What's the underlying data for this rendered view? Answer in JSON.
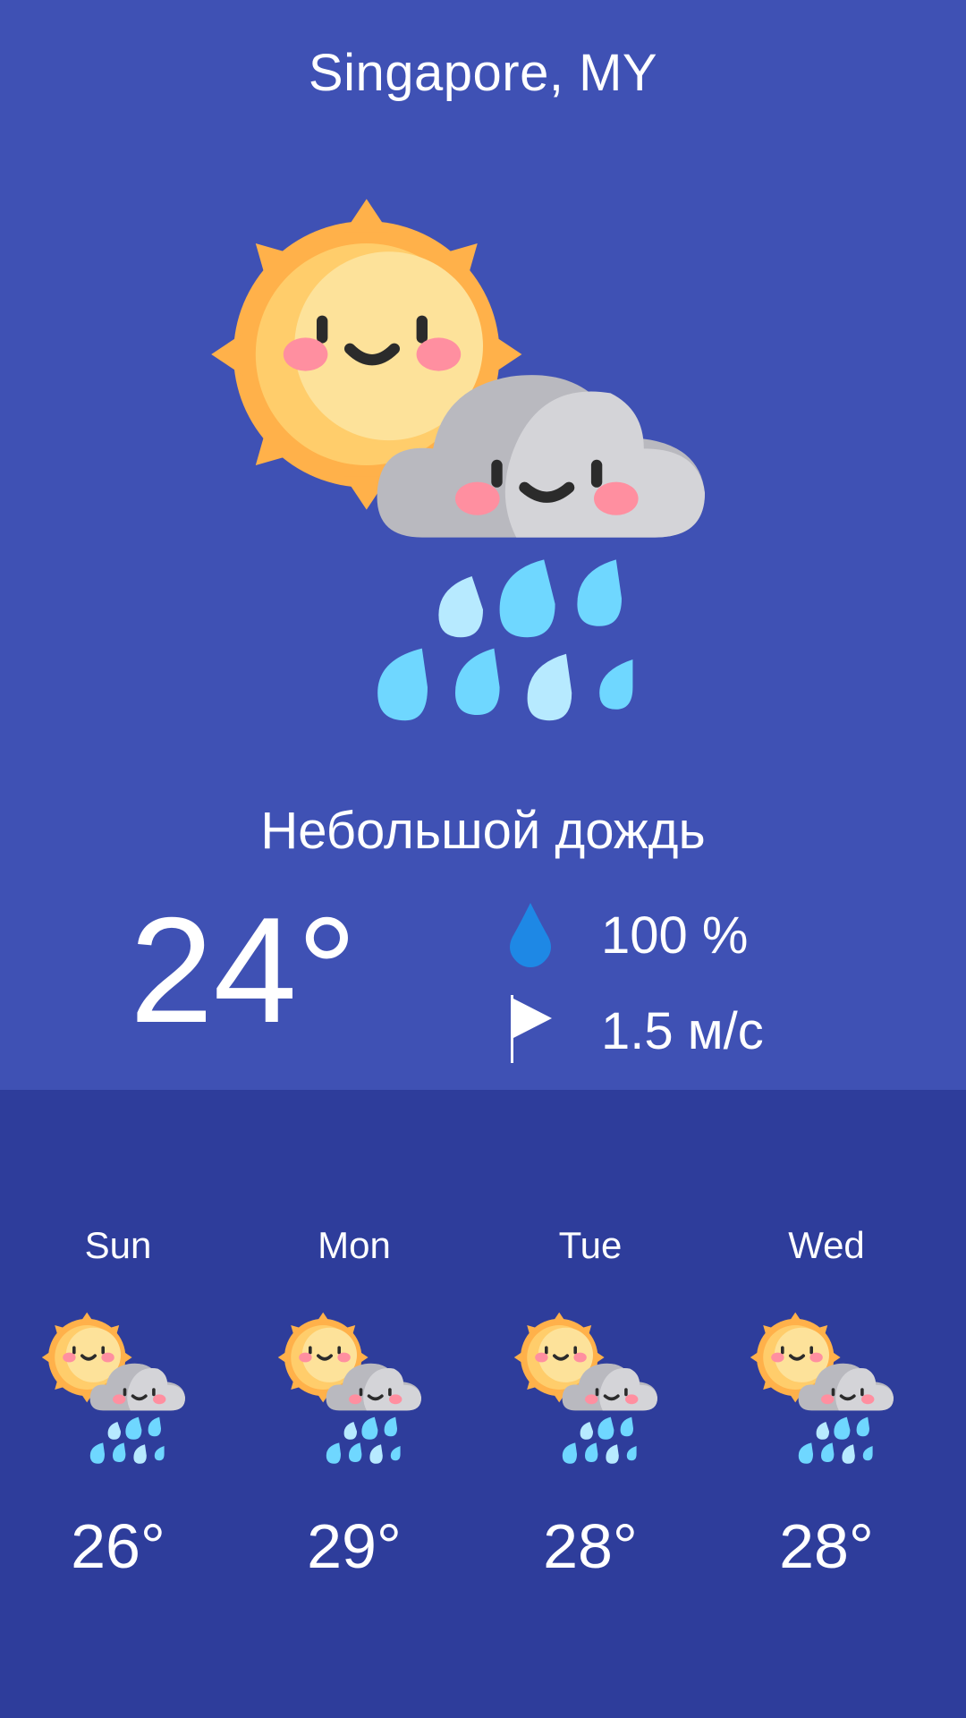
{
  "location": {
    "city": "Singapore, MY"
  },
  "current": {
    "condition": "Небольшой дождь",
    "temperature": "24°",
    "humidity": "100 %",
    "wind": "1.5 м/с",
    "icon": "sun-cloud-rain-icon"
  },
  "forecast": [
    {
      "day": "Sun",
      "temp": "26°",
      "icon": "sun-cloud-rain-icon"
    },
    {
      "day": "Mon",
      "temp": "29°",
      "icon": "sun-cloud-rain-icon"
    },
    {
      "day": "Tue",
      "temp": "28°",
      "icon": "sun-cloud-rain-icon"
    },
    {
      "day": "Wed",
      "temp": "28°",
      "icon": "sun-cloud-rain-icon"
    }
  ],
  "colors": {
    "top_background": "#3f51b4",
    "bottom_background": "#2e3d9b",
    "humidity_drop": "#1e88e5",
    "text": "#ffffff"
  }
}
